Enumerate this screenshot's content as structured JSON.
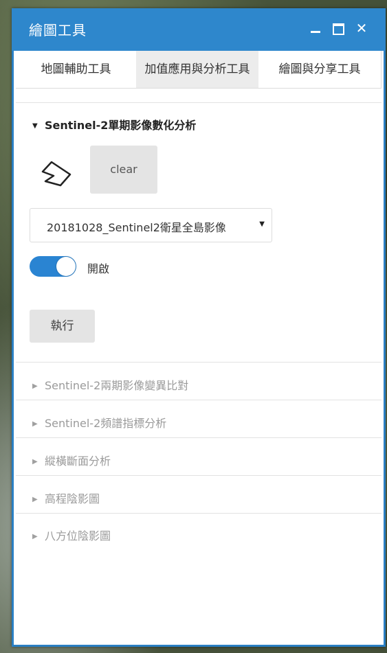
{
  "window": {
    "title": "繪圖工具",
    "minimize_icon": "minimize-icon",
    "maximize_icon": "maximize-icon",
    "close_icon": "close-icon",
    "close_glyph": "✕",
    "accent_color": "#2e87cc"
  },
  "tabs": [
    {
      "label": "地圖輔助工具"
    },
    {
      "label": "加值應用與分析工具",
      "active": true
    },
    {
      "label": "繪圖與分享工具"
    }
  ],
  "sections": [
    {
      "label": "Sentinel-2單期影像數化分析",
      "expanded": true
    },
    {
      "label": "Sentinel-2兩期影像變異比對",
      "expanded": false
    },
    {
      "label": "Sentinel-2頻譜指標分析",
      "expanded": false
    },
    {
      "label": "縱橫斷面分析",
      "expanded": false
    },
    {
      "label": "高程陰影圖",
      "expanded": false
    },
    {
      "label": "八方位陰影圖",
      "expanded": false
    }
  ],
  "expanded_section": {
    "draw_icon": "polygon-icon",
    "clear_label": "clear",
    "image_select_value": "20181028_Sentinel2衛星全島影像",
    "toggle_label": "開啟",
    "toggle_on": true,
    "run_label": "執行"
  },
  "arrows": {
    "open": "▼",
    "closed": "▶"
  }
}
